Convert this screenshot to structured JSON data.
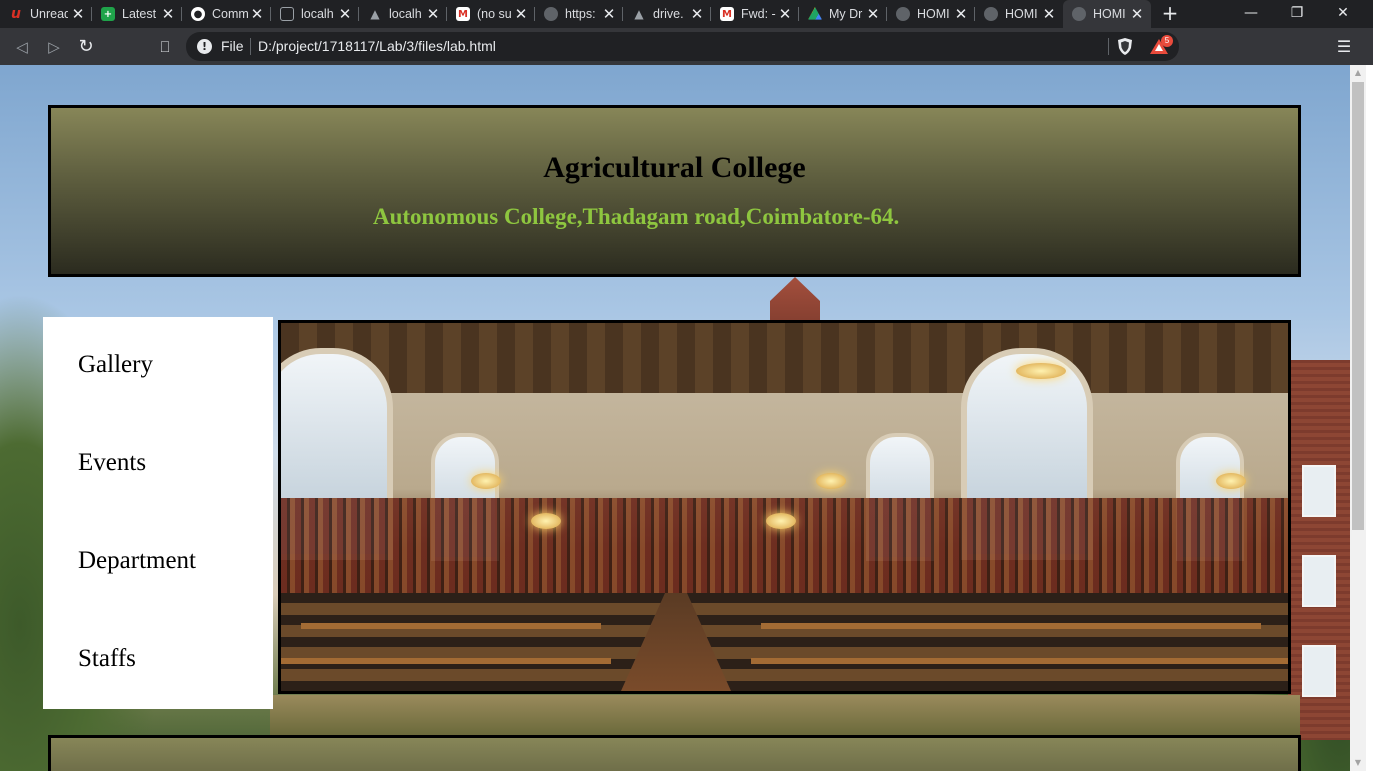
{
  "browser": {
    "tabs": [
      {
        "title": "Unread",
        "icon": "unread-icon",
        "icon_color": "#d93025",
        "active": false
      },
      {
        "title": "Latest",
        "icon": "plus-puzzle-icon",
        "icon_color": "#1fa34a",
        "active": false
      },
      {
        "title": "Comm",
        "icon": "github-icon",
        "icon_color": "#ffffff",
        "active": false
      },
      {
        "title": "localh",
        "icon": "chip-icon",
        "icon_color": "#9aa0a6",
        "active": false
      },
      {
        "title": "localh",
        "icon": "triangle-icon",
        "icon_color": "#9aa0a6",
        "active": false
      },
      {
        "title": "(no su",
        "icon": "gmail-icon",
        "icon_color": "#d93025",
        "active": false
      },
      {
        "title": "https:",
        "icon": "globe-icon",
        "icon_color": "#9aa0a6",
        "active": false
      },
      {
        "title": "drive.",
        "icon": "drive-gray-icon",
        "icon_color": "#9aa0a6",
        "active": false
      },
      {
        "title": "Fwd: -",
        "icon": "gmail-icon",
        "icon_color": "#d93025",
        "active": false
      },
      {
        "title": "My Dr",
        "icon": "google-drive-icon",
        "icon_color": "#1fa463",
        "active": false
      },
      {
        "title": "HOMI",
        "icon": "globe-icon",
        "icon_color": "#9aa0a6",
        "active": false
      },
      {
        "title": "HOMI",
        "icon": "globe-icon",
        "icon_color": "#9aa0a6",
        "active": false
      },
      {
        "title": "HOMI",
        "icon": "globe-icon",
        "icon_color": "#9aa0a6",
        "active": true
      }
    ],
    "new_tab_glyph": "+",
    "close_glyph": "✕",
    "window_controls": {
      "minimize": "—",
      "maximize": "❐",
      "close": "✕"
    },
    "toolbar": {
      "back_glyph": "◁",
      "forward_glyph": "▷",
      "reload_glyph": "↻",
      "bookmark_glyph": "⎕",
      "info_glyph": "!",
      "scheme_label": "File",
      "url": "D:/project/1718117/Lab/3/files/lab.html",
      "rewards_badge": "5",
      "menu_glyph": "☰"
    }
  },
  "page": {
    "header": {
      "title": "Agricultural College",
      "subtitle": "Autonomous College,Thadagam road,Coimbatore-64."
    },
    "nav": [
      "Gallery",
      "Events",
      "Department",
      "Staffs"
    ],
    "colors": {
      "header_top": "#878658",
      "header_bottom": "#2b2b1f",
      "subtitle": "#8ec63f",
      "nav_bg": "#ffffff",
      "border": "#000000"
    }
  },
  "scrollbar": {
    "up_glyph": "▲",
    "down_glyph": "▼"
  }
}
